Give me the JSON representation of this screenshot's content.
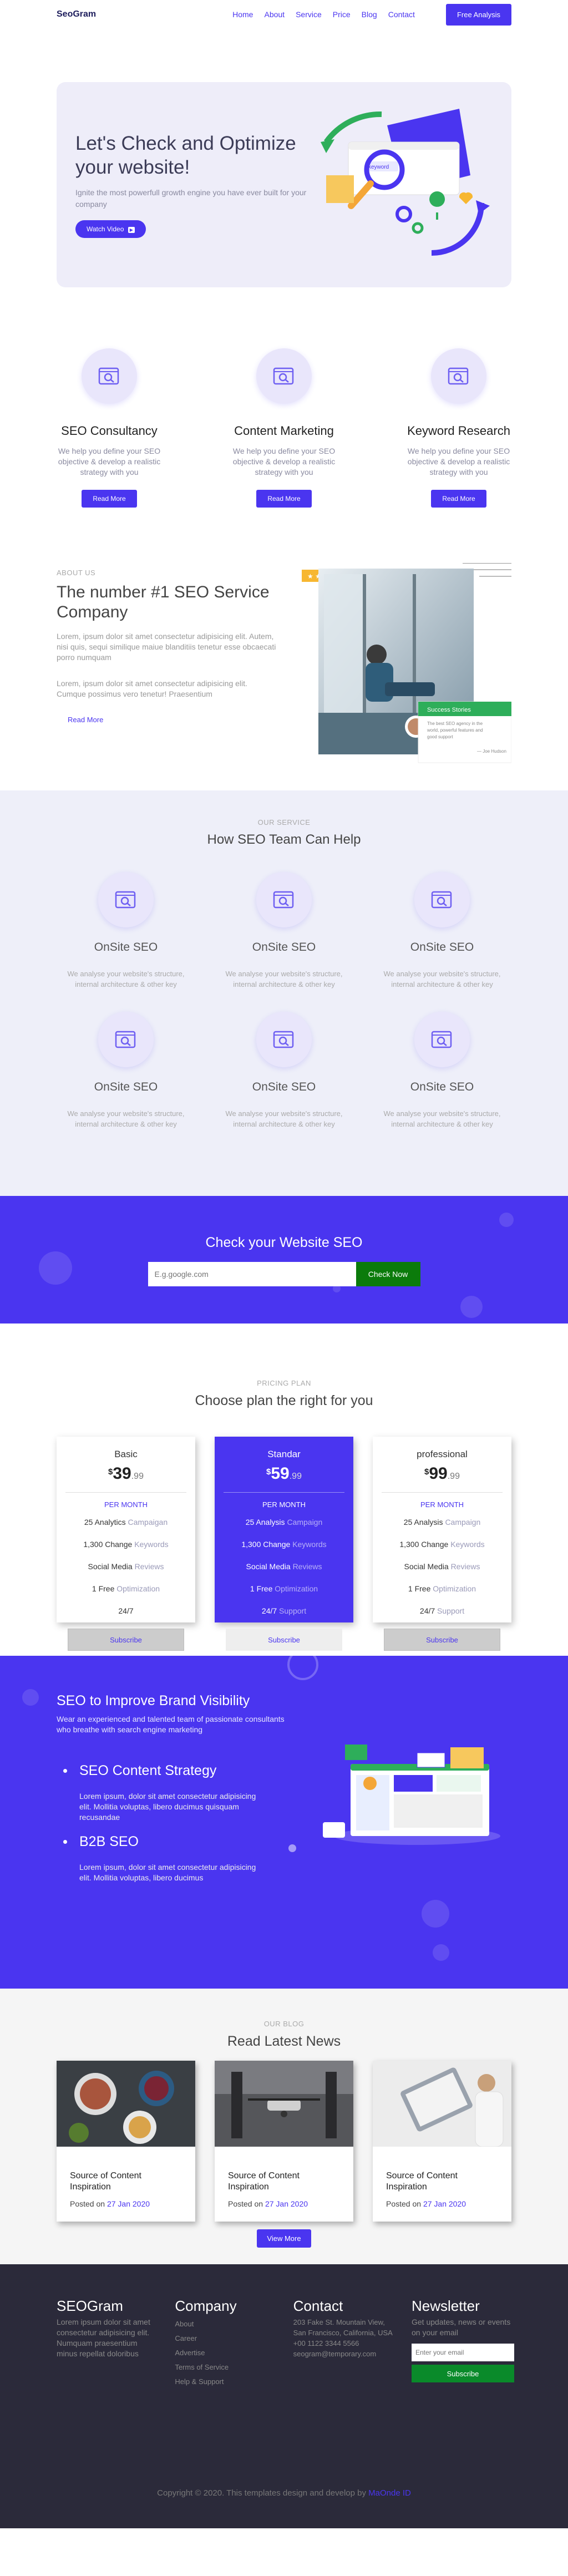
{
  "header": {
    "logo": "SeoGram",
    "nav": [
      "Home",
      "About",
      "Service",
      "Price",
      "Blog",
      "Contact"
    ],
    "cta": "Free Analysis"
  },
  "hero": {
    "title": "Let's Check and Optimize your website!",
    "text": "Ignite the most powerfull growth engine you have ever built for your company",
    "button": "Watch Video",
    "art_label": "keyword"
  },
  "services": [
    {
      "title": "SEO Consultancy",
      "text": "We help you define your SEO objective & develop a realistic strategy with you",
      "button": "Read More"
    },
    {
      "title": "Content Marketing",
      "text": "We help you define your SEO objective & develop a realistic strategy with you",
      "button": "Read More"
    },
    {
      "title": "Keyword Research",
      "text": "We help you define your SEO objective & develop a realistic strategy with you",
      "button": "Read More"
    }
  ],
  "about": {
    "tag": "ABOUT US",
    "title": "The number #1 SEO Service Company",
    "p1": "Lorem, ipsum dolor sit amet consectetur adipisicing elit. Autem, nisi quis, sequi similique maiue blanditiis tenetur esse obcaecati porro numquam",
    "p2": "Lorem, ipsum dolor sit amet consectetur adipisicing elit. Cumque possimus vero tenetur! Praesentium",
    "link": "Read More",
    "card_title": "Success Stories",
    "card_text": "The best SEO agency in the world, powerful features and good support",
    "card_author": "— Joe Hudson"
  },
  "help": {
    "tag": "OUR SERVICE",
    "title": "How SEO Team Can Help",
    "items": [
      {
        "title": "OnSite SEO",
        "text": "We analyse your website's structure, internal architecture & other key"
      },
      {
        "title": "OnSite SEO",
        "text": "We analyse your website's structure, internal architecture & other key"
      },
      {
        "title": "OnSite SEO",
        "text": "We analyse your website's structure, internal architecture & other key"
      },
      {
        "title": "OnSite SEO",
        "text": "We analyse your website's structure, internal architecture & other key"
      },
      {
        "title": "OnSite SEO",
        "text": "We analyse your website's structure, internal architecture & other key"
      },
      {
        "title": "OnSite SEO",
        "text": "We analyse your website's structure, internal architecture & other key"
      }
    ]
  },
  "check": {
    "title": "Check your Website SEO",
    "placeholder": "E.g.google.com",
    "button": "Check Now"
  },
  "pricing": {
    "tag": "PRICING PLAN",
    "title": "Choose plan the right for you",
    "plans": [
      {
        "name": "Basic",
        "currency": "$",
        "price": "39",
        "cents": ".99",
        "period": "PER MONTH",
        "features": [
          [
            "25 Analytics",
            "Campaigan"
          ],
          [
            "1,300 Change",
            "Keywords"
          ],
          [
            "Social Media",
            "Reviews"
          ],
          [
            "1 Free",
            "Optimization"
          ],
          [
            "24/7",
            ""
          ]
        ],
        "button": "Subscribe"
      },
      {
        "name": "Standar",
        "currency": "$",
        "price": "59",
        "cents": ".99",
        "period": "PER MONTH",
        "features": [
          [
            "25 Analysis",
            "Campaign"
          ],
          [
            "1,300 Change",
            "Keywords"
          ],
          [
            "Social Media",
            "Reviews"
          ],
          [
            "1 Free",
            "Optimization"
          ],
          [
            "24/7",
            "Support"
          ]
        ],
        "button": "Subscribe"
      },
      {
        "name": "professional",
        "currency": "$",
        "price": "99",
        "cents": ".99",
        "period": "PER MONTH",
        "features": [
          [
            "25 Analysis",
            "Campaign"
          ],
          [
            "1,300 Change",
            "Keywords"
          ],
          [
            "Social Media",
            "Reviews"
          ],
          [
            "1 Free",
            "Optimization"
          ],
          [
            "24/7",
            "Support"
          ]
        ],
        "button": "Subscribe"
      }
    ]
  },
  "brand": {
    "title": "SEO to Improve Brand Visibility",
    "lead": "Wear an experienced and talented team of passionate consultants who breathe with search engine marketing",
    "items": [
      {
        "title": "SEO Content Strategy",
        "text": "Lorem ipsum, dolor sit amet consectetur adipisicing elit. Mollitia voluptas, libero ducimus quisquam recusandae"
      },
      {
        "title": "B2B SEO",
        "text": "Lorem ipsum, dolor sit amet consectetur adipisicing elit. Mollitia voluptas, libero ducimus"
      }
    ]
  },
  "blog": {
    "tag": "OUR BLOG",
    "title": "Read Latest News",
    "posts": [
      {
        "title": "Source of Content Inspiration",
        "posted": "Posted on",
        "date": "27 Jan 2020"
      },
      {
        "title": "Source of Content Inspiration",
        "posted": "Posted on",
        "date": "27 Jan 2020"
      },
      {
        "title": "Source of Content Inspiration",
        "posted": "Posted on",
        "date": "27 Jan 2020"
      }
    ],
    "button": "View More"
  },
  "footer": {
    "about_title": "SEOGram",
    "about_text": "Lorem ipsum dolor sit amet consectetur adipisicing elit. Numquam praesentium minus repellat doloribus",
    "company_title": "Company",
    "company_links": [
      "About",
      "Career",
      "Advertise",
      "Terms of Service",
      "Help & Support"
    ],
    "contact_title": "Contact",
    "contact_text": "203 Fake St. Mountain View, San Francisco, California, USA",
    "phone": "+00 1122 3344 5566",
    "email": "seogram@temporary.com",
    "news_title": "Newsletter",
    "news_text": "Get updates, news or events on your email",
    "news_placeholder": "Enter your email",
    "news_button": "Subscribe",
    "copyright": "Copyright © 2020. This templates design and develop by",
    "copyright_author": "MaOnde ID"
  },
  "colors": {
    "accent": "#4a35f0",
    "green": "#0b7b0b",
    "footer": "#2b2a3a",
    "light": "#eeedf9"
  }
}
